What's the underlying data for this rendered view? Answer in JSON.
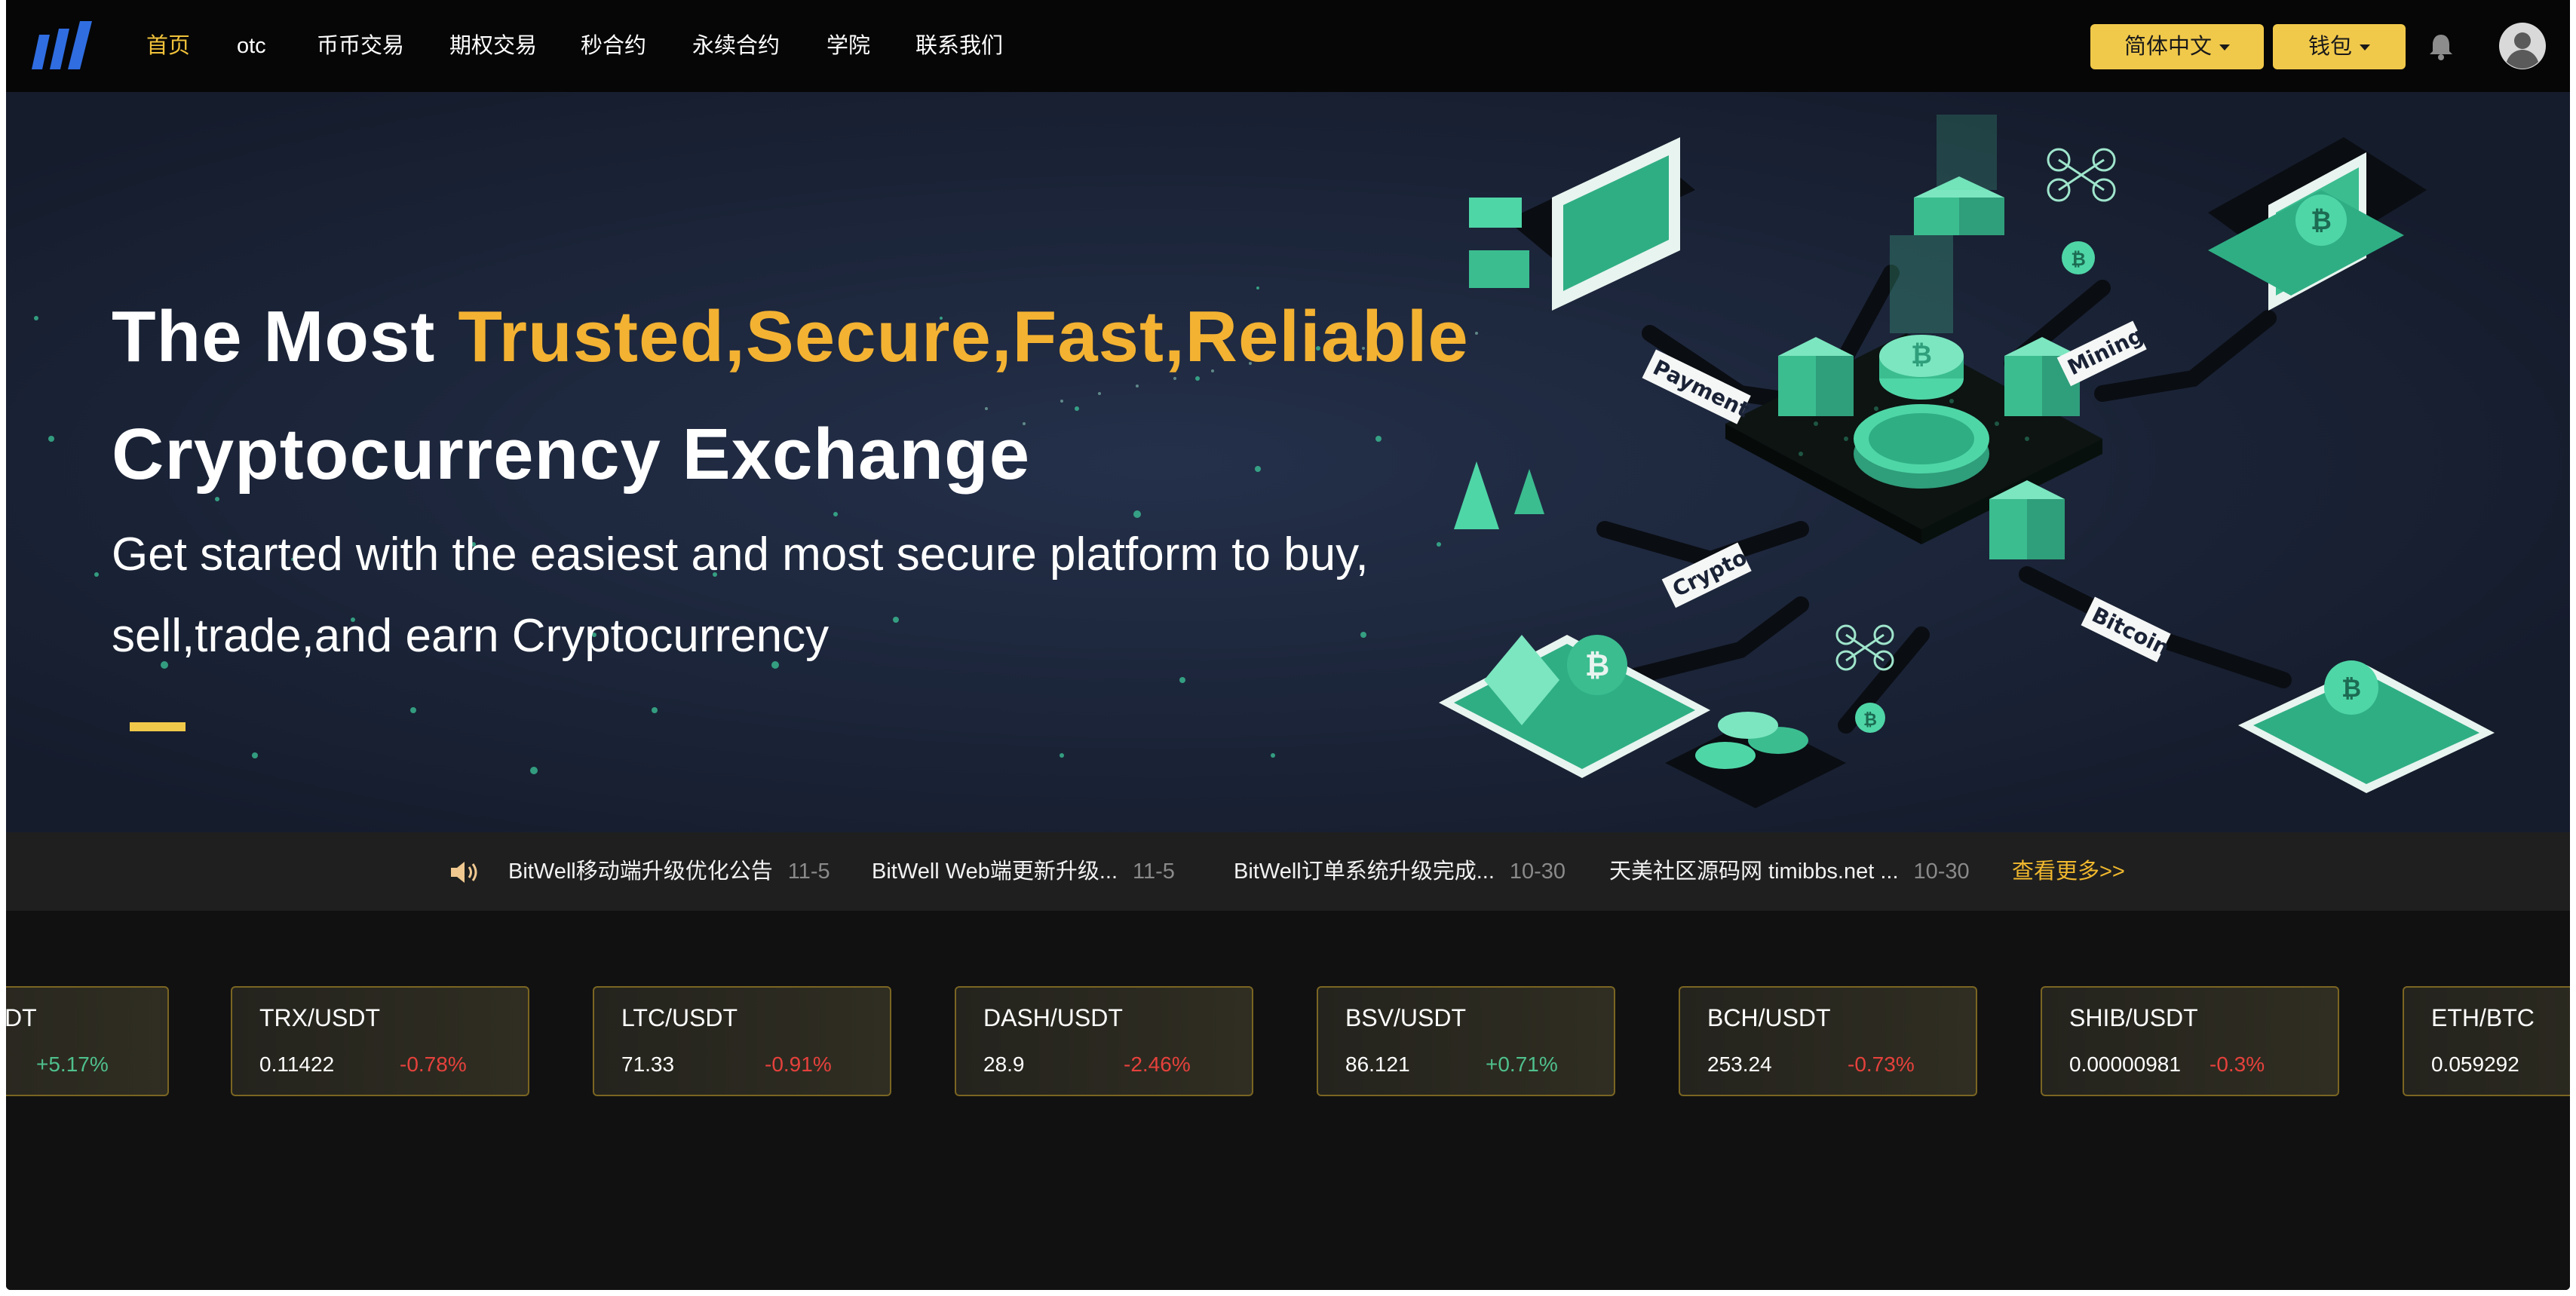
{
  "nav": {
    "items": [
      {
        "label": "首页",
        "active": true
      },
      {
        "label": "otc"
      },
      {
        "label": "币币交易"
      },
      {
        "label": "期权交易"
      },
      {
        "label": "秒合约"
      },
      {
        "label": "永续合约"
      },
      {
        "label": "学院"
      },
      {
        "label": "联系我们"
      }
    ],
    "language_button": "简体中文",
    "wallet_button": "钱包",
    "icons": [
      "logo",
      "bell-icon",
      "avatar-icon"
    ]
  },
  "hero": {
    "headline_prefix": "The Most",
    "headline_highlight": "Trusted,Secure,Fast,Reliable",
    "headline_line2": "Cryptocurrency Exchange",
    "subtext": "Get started with the easiest and most secure platform to buy, sell,trade,and earn Cryptocurrency",
    "illustration_labels": [
      "Payment",
      "Mining",
      "Crypto",
      "Bitcoin"
    ]
  },
  "notices": {
    "items": [
      {
        "title": "BitWell移动端升级优化公告",
        "date": "11-5"
      },
      {
        "title": "BitWell Web端更新升级...",
        "date": "11-5"
      },
      {
        "title": "BitWell订单系统升级完成...",
        "date": "10-30"
      },
      {
        "title": "天美社区源码网 timibbs.net ...",
        "date": "10-30"
      }
    ],
    "more_label": "查看更多>>"
  },
  "tickers": [
    {
      "pair": "DT",
      "price": "",
      "change": "+5.17%",
      "direction": "up"
    },
    {
      "pair": "TRX/USDT",
      "price": "0.11422",
      "change": "-0.78%",
      "direction": "down"
    },
    {
      "pair": "LTC/USDT",
      "price": "71.33",
      "change": "-0.91%",
      "direction": "down"
    },
    {
      "pair": "DASH/USDT",
      "price": "28.9",
      "change": "-2.46%",
      "direction": "down"
    },
    {
      "pair": "BSV/USDT",
      "price": "86.121",
      "change": "+0.71%",
      "direction": "up"
    },
    {
      "pair": "BCH/USDT",
      "price": "253.24",
      "change": "-0.73%",
      "direction": "down"
    },
    {
      "pair": "SHIB/USDT",
      "price": "0.00000981",
      "change": "-0.3%",
      "direction": "down"
    },
    {
      "pair": "ETH/BTC",
      "price": "0.059292",
      "change": "",
      "direction": ""
    }
  ],
  "colors": {
    "accent": "#f1c94a",
    "headline_highlight": "#f3b232",
    "up": "#4fc08d",
    "down": "#e5413c",
    "hero_bg": "#1a2236",
    "mint": "#4fd6a7"
  }
}
